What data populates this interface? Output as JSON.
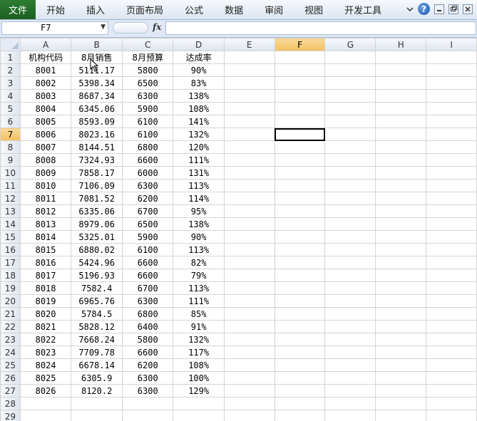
{
  "ribbon": {
    "file_label": "文件",
    "tabs": [
      "开始",
      "插入",
      "页面布局",
      "公式",
      "数据",
      "审阅",
      "视图",
      "开发工具"
    ],
    "help_label": "?"
  },
  "formula_bar": {
    "name_box": "F7",
    "fx_label": "fx",
    "formula_value": ""
  },
  "columns": [
    "A",
    "B",
    "C",
    "D",
    "E",
    "F",
    "G",
    "H",
    "I"
  ],
  "selected_cell": "F7",
  "headers": [
    "机构代码",
    "8月销售",
    "8月预算",
    "达成率"
  ],
  "rows": [
    [
      "8001",
      "5111.17",
      "5800",
      "90%"
    ],
    [
      "8002",
      "5398.34",
      "6500",
      "83%"
    ],
    [
      "8003",
      "8687.34",
      "6300",
      "138%"
    ],
    [
      "8004",
      "6345.06",
      "5900",
      "108%"
    ],
    [
      "8005",
      "8593.09",
      "6100",
      "141%"
    ],
    [
      "8006",
      "8023.16",
      "6100",
      "132%"
    ],
    [
      "8007",
      "8144.51",
      "6800",
      "120%"
    ],
    [
      "8008",
      "7324.93",
      "6600",
      "111%"
    ],
    [
      "8009",
      "7858.17",
      "6000",
      "131%"
    ],
    [
      "8010",
      "7106.09",
      "6300",
      "113%"
    ],
    [
      "8011",
      "7081.52",
      "6200",
      "114%"
    ],
    [
      "8012",
      "6335.06",
      "6700",
      "95%"
    ],
    [
      "8013",
      "8979.06",
      "6500",
      "138%"
    ],
    [
      "8014",
      "5325.01",
      "5900",
      "90%"
    ],
    [
      "8015",
      "6880.02",
      "6100",
      "113%"
    ],
    [
      "8016",
      "5424.96",
      "6600",
      "82%"
    ],
    [
      "8017",
      "5196.93",
      "6600",
      "79%"
    ],
    [
      "8018",
      "7582.4",
      "6700",
      "113%"
    ],
    [
      "8019",
      "6965.76",
      "6300",
      "111%"
    ],
    [
      "8020",
      "5784.5",
      "6800",
      "85%"
    ],
    [
      "8021",
      "5828.12",
      "6400",
      "91%"
    ],
    [
      "8022",
      "7668.24",
      "5800",
      "132%"
    ],
    [
      "8023",
      "7709.78",
      "6600",
      "117%"
    ],
    [
      "8024",
      "6678.14",
      "6200",
      "108%"
    ],
    [
      "8025",
      "6305.9",
      "6300",
      "100%"
    ],
    [
      "8026",
      "8120.2",
      "6300",
      "129%"
    ]
  ],
  "empty_rows": [
    "28",
    "29"
  ]
}
